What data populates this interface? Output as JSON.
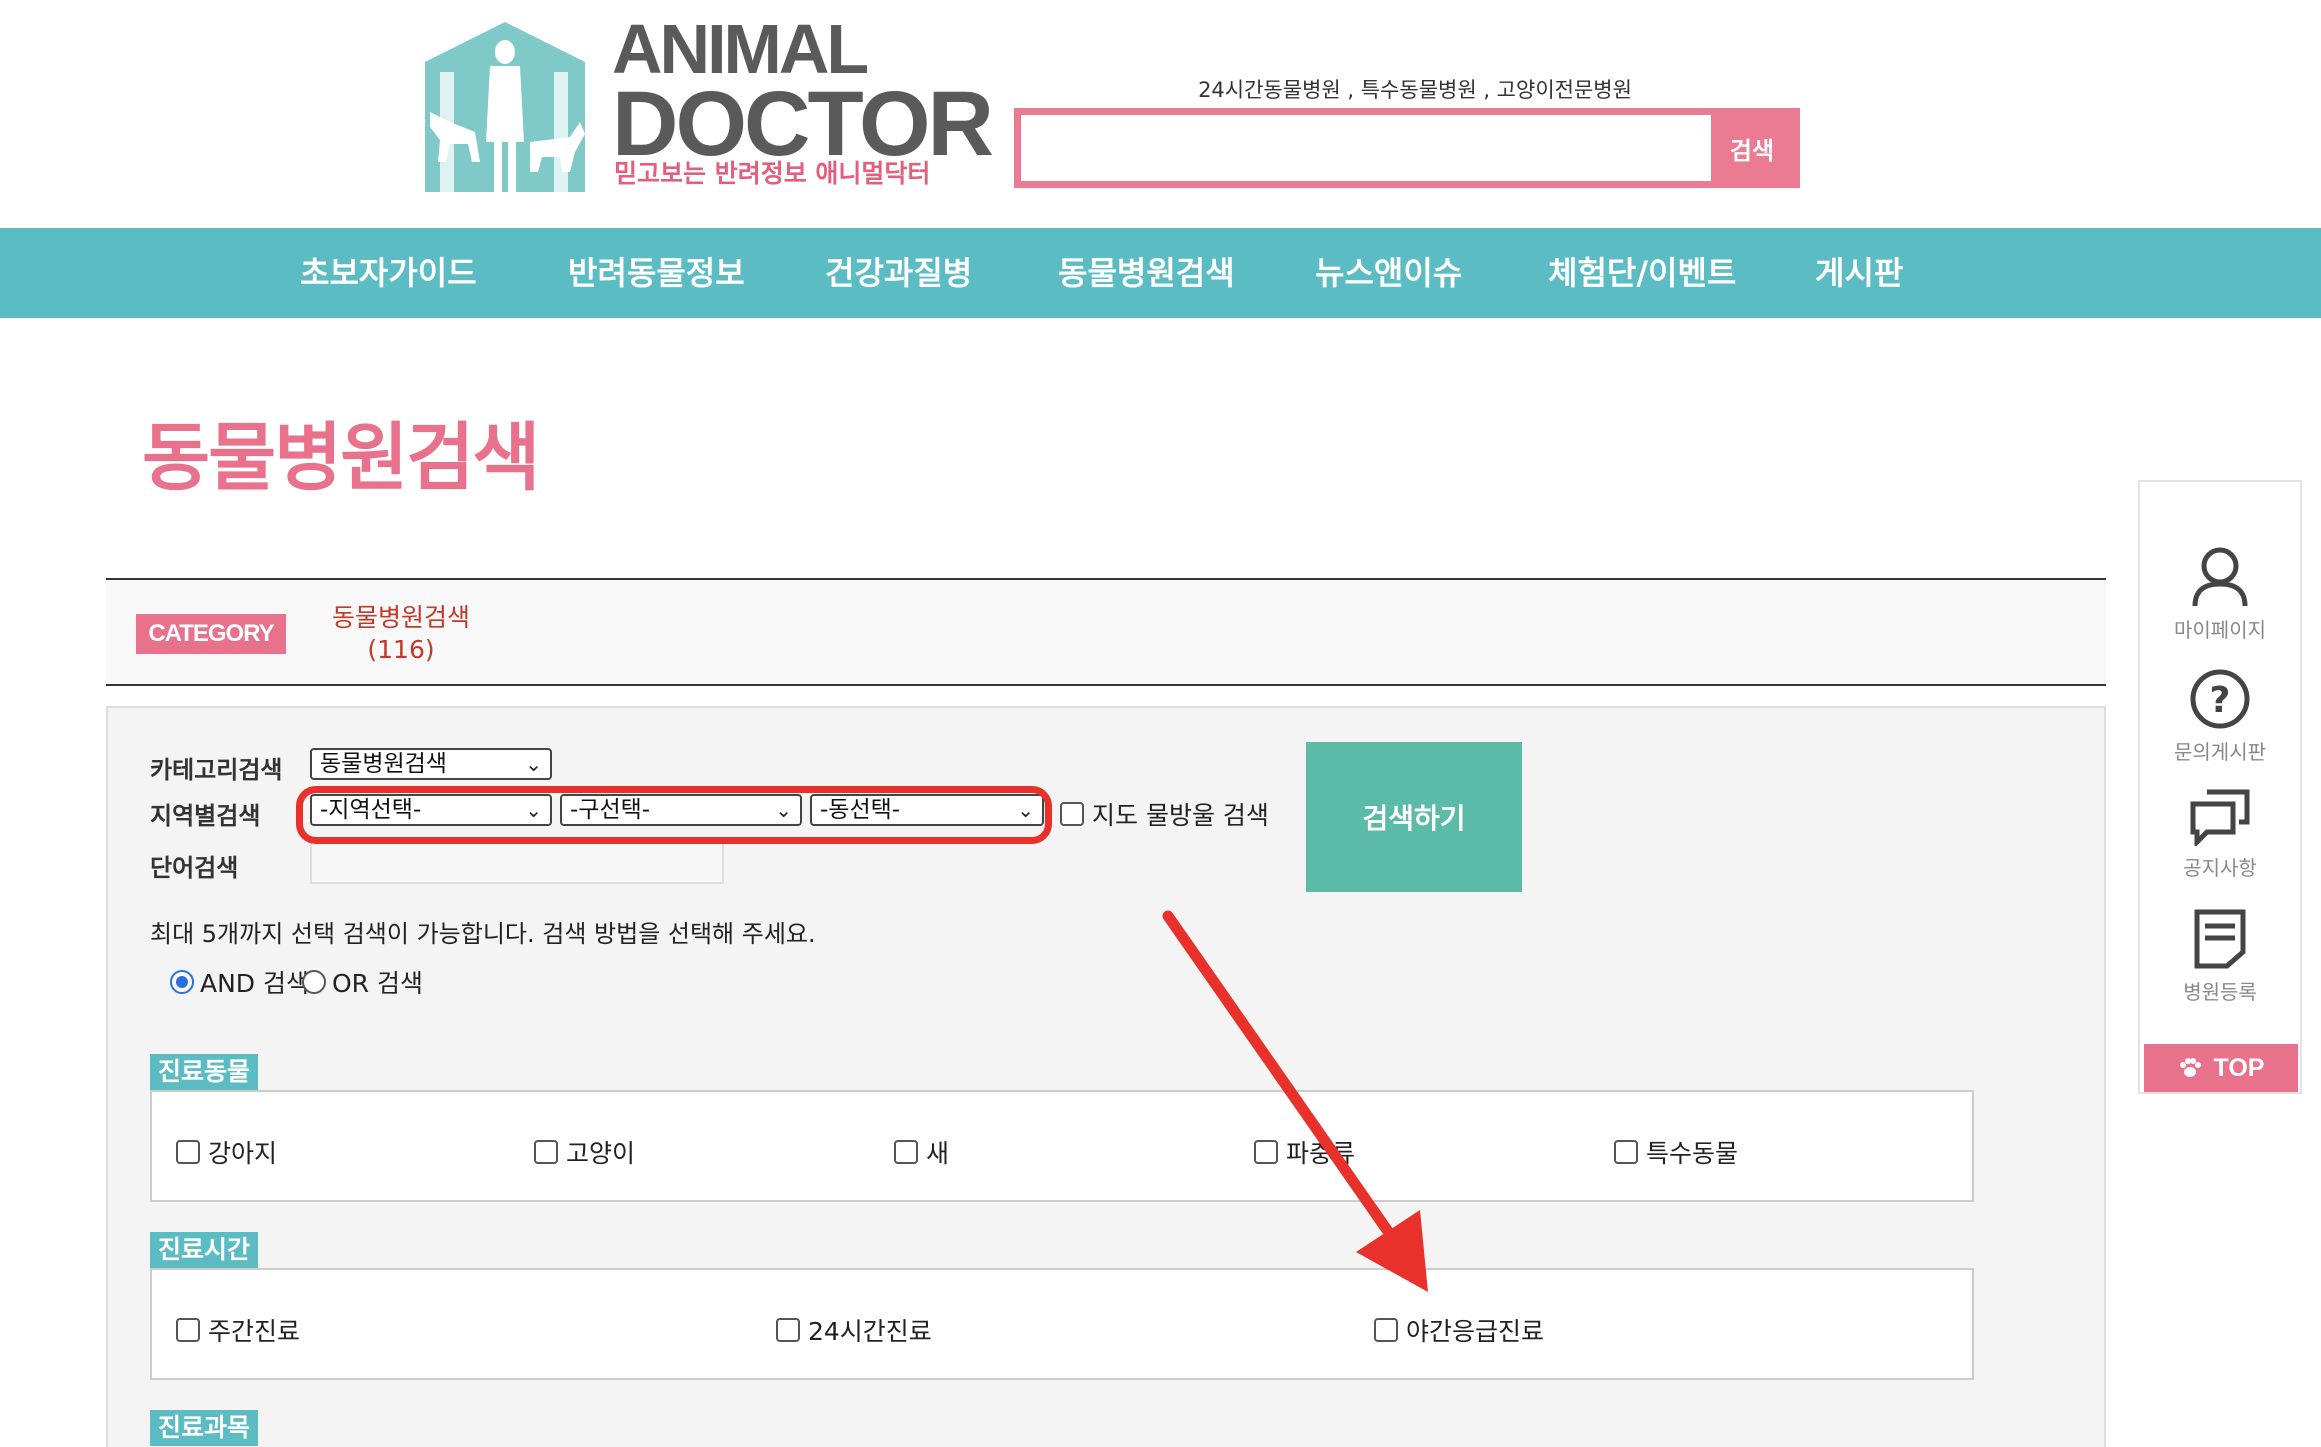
{
  "header": {
    "logo_word_1": "ANIMAL",
    "logo_word_2": "DOCTOR",
    "logo_tagline": "믿고보는 반려정보 애니멀닥터",
    "search_hint": "24시간동물병원 , 특수동물병원 , 고양이전문병원",
    "search_value": "",
    "search_button": "검색"
  },
  "nav": {
    "items": [
      {
        "label": "초보자가이드"
      },
      {
        "label": "반려동물정보"
      },
      {
        "label": "건강과질병"
      },
      {
        "label": "동물병원검색"
      },
      {
        "label": "뉴스앤이슈"
      },
      {
        "label": "체험단/이벤트"
      },
      {
        "label": "게시판"
      }
    ]
  },
  "page_title": "동물병원검색",
  "category": {
    "badge": "CATEGORY",
    "name": "동물병원검색",
    "count": "(116)"
  },
  "form": {
    "category_label": "카테고리검색",
    "category_value": "동물병원검색",
    "region_label": "지역별검색",
    "region_select_1": "-지역선택-",
    "region_select_2": "-구선택-",
    "region_select_3": "-동선택-",
    "map_option": "지도 물방울 검색",
    "word_label": "단어검색",
    "word_value": "",
    "submit_label": "검색하기",
    "note": "최대 5개까지 선택 검색이 가능합니다. 검색 방법을 선택해 주세요.",
    "and_label": "AND 검색",
    "or_label": "OR 검색",
    "selected_mode": "AND"
  },
  "sections": {
    "animals": {
      "title": "진료동물",
      "options": [
        "강아지",
        "고양이",
        "새",
        "파충류",
        "특수동물"
      ]
    },
    "hours": {
      "title": "진료시간",
      "options": [
        "주간진료",
        "24시간진료",
        "야간응급진료"
      ]
    },
    "departments": {
      "title": "진료과목"
    }
  },
  "quickbar": {
    "mypage": "마이페이지",
    "qna": "문의게시판",
    "notice": "공지사항",
    "register": "병원등록",
    "top": "TOP"
  },
  "annotation_color": "#e8312a"
}
